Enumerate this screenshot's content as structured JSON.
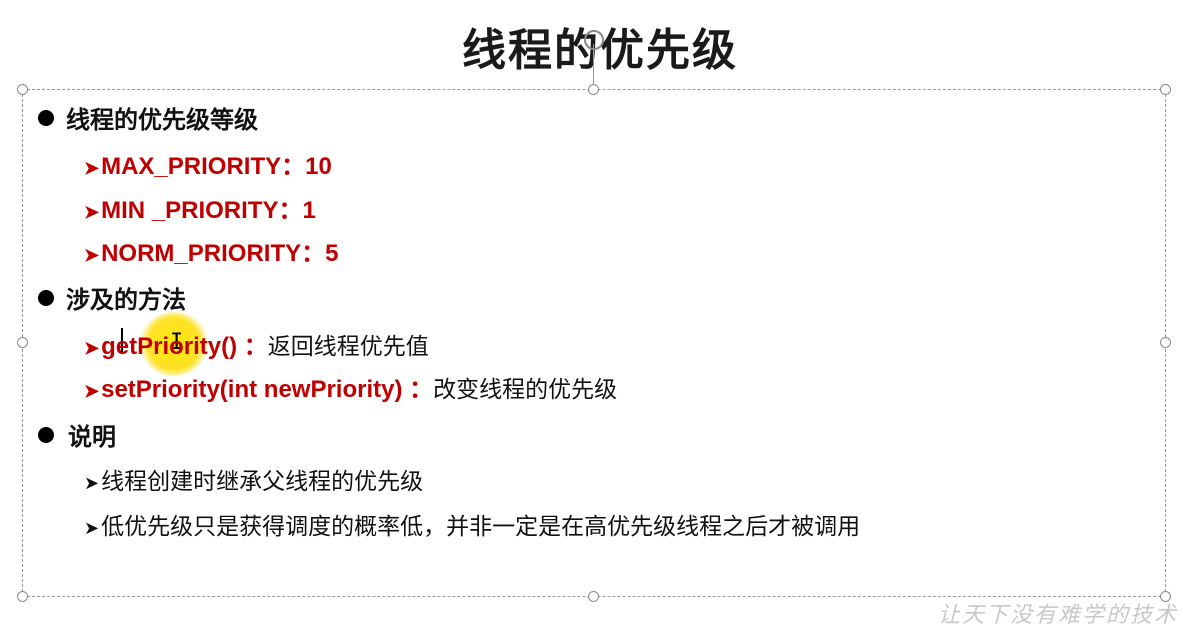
{
  "slide": {
    "title": "线程的优先级",
    "sections": [
      {
        "heading": "线程的优先级等级",
        "items": [
          "MAX_PRIORITY：10",
          "MIN _PRIORITY：1",
          "NORM_PRIORITY：5"
        ]
      },
      {
        "heading": "涉及的方法",
        "items": [
          {
            "code": "getPriority()",
            "sep": " ：",
            "desc": "返回线程优先值"
          },
          {
            "code": "setPriority(int newPriority)",
            "sep": " ：",
            "desc": "改变线程的优先级"
          }
        ]
      },
      {
        "heading": "说明",
        "items": [
          "线程创建时继承父线程的优先级",
          "低优先级只是获得调度的概率低，并非一定是在高优先级线程之后才被调用"
        ]
      }
    ]
  },
  "watermark": "让天下没有难学的技术",
  "colors": {
    "accent_red": "#c00000",
    "text": "#111111",
    "cursor_highlight": "#ffe100"
  },
  "icons": {
    "bullet": "filled-circle-icon",
    "sub_bullet": "arrowhead-icon"
  }
}
